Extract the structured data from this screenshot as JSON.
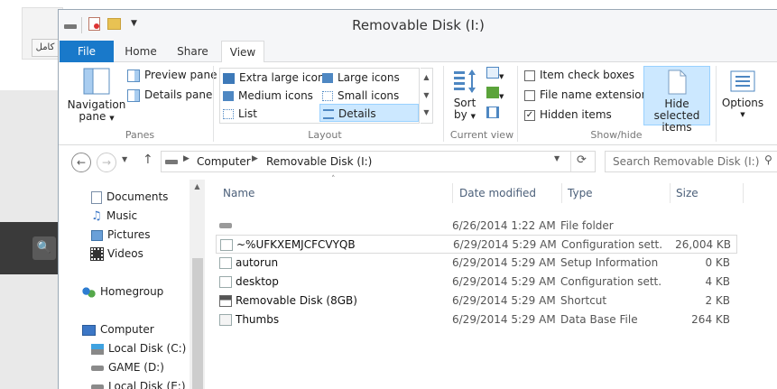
{
  "background": {
    "arabic_label": "كامل"
  },
  "window": {
    "title": "Removable Disk (I:)"
  },
  "tabs": [
    {
      "label": "File"
    },
    {
      "label": "Home"
    },
    {
      "label": "Share"
    },
    {
      "label": "View"
    }
  ],
  "ribbon": {
    "panes": {
      "navigation_pane": "Navigation",
      "navigation_pane_2": "pane",
      "preview_pane": "Preview pane",
      "details_pane": "Details pane",
      "label": "Panes"
    },
    "layout": {
      "items": [
        "Extra large icons",
        "Large icons",
        "Medium icons",
        "Small icons",
        "List",
        "Details"
      ],
      "selected": "Details",
      "label": "Layout"
    },
    "current_view": {
      "sort_by": "Sort",
      "sort_by_2": "by",
      "label": "Current view"
    },
    "show_hide": {
      "item_check_boxes": "Item check boxes",
      "file_name_extensions": "File name extensions",
      "hidden_items": "Hidden items",
      "hide_selected": "Hide selected",
      "hide_selected_2": "items",
      "label": "Show/hide",
      "checks": {
        "item_check_boxes": false,
        "file_name_extensions": false,
        "hidden_items": true
      }
    },
    "options": {
      "label": "Options"
    }
  },
  "address": {
    "path": [
      "Computer",
      "Removable Disk (I:)"
    ],
    "search_placeholder": "Search Removable Disk (I:)"
  },
  "navpane": {
    "items": [
      {
        "label": "Documents",
        "icon": "documents-icon"
      },
      {
        "label": "Music",
        "icon": "music-icon"
      },
      {
        "label": "Pictures",
        "icon": "pictures-icon"
      },
      {
        "label": "Videos",
        "icon": "videos-icon"
      },
      {
        "label": "Homegroup",
        "icon": "homegroup-icon"
      },
      {
        "label": "Computer",
        "icon": "computer-icon"
      },
      {
        "label": "Local Disk (C:)",
        "icon": "local-disk-icon"
      },
      {
        "label": "GAME (D:)",
        "icon": "drive-icon"
      },
      {
        "label": "Local Disk (E:)",
        "icon": "drive-icon"
      }
    ]
  },
  "files": {
    "columns": [
      "Name",
      "Date modified",
      "Type",
      "Size"
    ],
    "rows": [
      {
        "name": "",
        "date": "6/26/2014 1:22 AM",
        "type": "File folder",
        "size": "",
        "icon": "folder-drive-icon"
      },
      {
        "name": "~%UFKXEMJCFCVYQB",
        "date": "6/29/2014 5:29 AM",
        "type": "Configuration sett...",
        "size": "26,004 KB",
        "icon": "config-file-icon"
      },
      {
        "name": "autorun",
        "date": "6/29/2014 5:29 AM",
        "type": "Setup Information",
        "size": "0 KB",
        "icon": "setup-file-icon"
      },
      {
        "name": "desktop",
        "date": "6/29/2014 5:29 AM",
        "type": "Configuration sett...",
        "size": "4 KB",
        "icon": "config-file-icon"
      },
      {
        "name": "Removable Disk (8GB)",
        "date": "6/29/2014 5:29 AM",
        "type": "Shortcut",
        "size": "2 KB",
        "icon": "shortcut-icon"
      },
      {
        "name": "Thumbs",
        "date": "6/29/2014 5:29 AM",
        "type": "Data Base File",
        "size": "264 KB",
        "icon": "database-file-icon"
      }
    ]
  },
  "colors": {
    "accent": "#1979ca",
    "selection": "#cce8ff",
    "header_text": "#4c607a"
  }
}
